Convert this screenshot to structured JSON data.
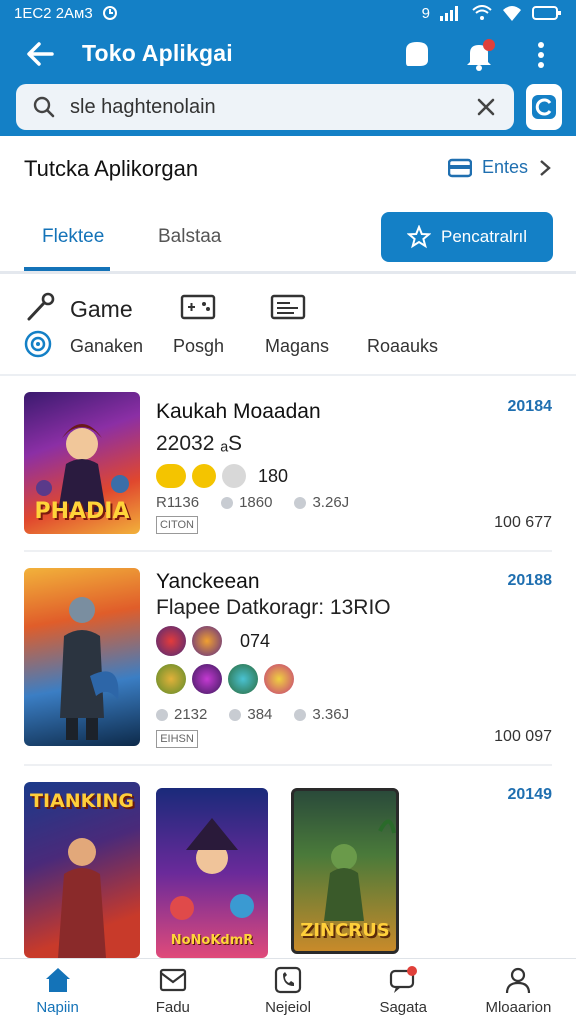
{
  "status": {
    "time": "1EC2 2Aᴍ3",
    "right": "9"
  },
  "header": {
    "title": "Toko Aplikgai",
    "notification_count": "0"
  },
  "search": {
    "value": "sle haghtenolain"
  },
  "page": {
    "title": "Tutcka Aplikorgan",
    "entries_label": "Entes"
  },
  "tabs": [
    {
      "label": "Flektee",
      "active": true
    },
    {
      "label": "Balstaa",
      "active": false
    }
  ],
  "pencarian_label": "Pencatralrıl",
  "categories": {
    "title": "Game",
    "items": [
      {
        "label": "Ganaken",
        "icon": "target-icon"
      },
      {
        "label": "Posgh",
        "icon": "gamepad-icon"
      },
      {
        "label": "Magans",
        "icon": "list-icon"
      },
      {
        "label": "Roaauks",
        "icon": "none"
      }
    ]
  },
  "apps": [
    {
      "name": "Kaukah Moaadan",
      "sub": "22032 ₐS",
      "rating": "180",
      "year": "20184",
      "meta": [
        "R1136",
        "1860",
        "3.26J"
      ],
      "tag": "CITON",
      "size": "100 677",
      "thumb_text": "PHADIA"
    },
    {
      "name": "Yanckeean",
      "sub": "Flapee Datkoragr: 13RIO",
      "rating": "074",
      "year": "20188",
      "meta": [
        "2132",
        "384",
        "3.36J"
      ],
      "tag": "EIHSN",
      "size": "100 097"
    },
    {
      "name": "",
      "sub": "",
      "year": "20149",
      "thumbs": [
        "TIANKING",
        "NoNoKdmR",
        "ZINCRUS"
      ]
    }
  ],
  "bottom_nav": [
    {
      "label": "Napiin",
      "icon": "home-icon",
      "active": true
    },
    {
      "label": "Fadu",
      "icon": "mail-icon",
      "active": false
    },
    {
      "label": "Nejeiol",
      "icon": "phone-icon",
      "active": false
    },
    {
      "label": "Sagata",
      "icon": "chat-icon",
      "active": false,
      "badge": "0"
    },
    {
      "label": "Mloaarion",
      "icon": "person-icon",
      "active": false
    }
  ],
  "colors": {
    "primary": "#1480c6",
    "accent": "#1473b8"
  }
}
